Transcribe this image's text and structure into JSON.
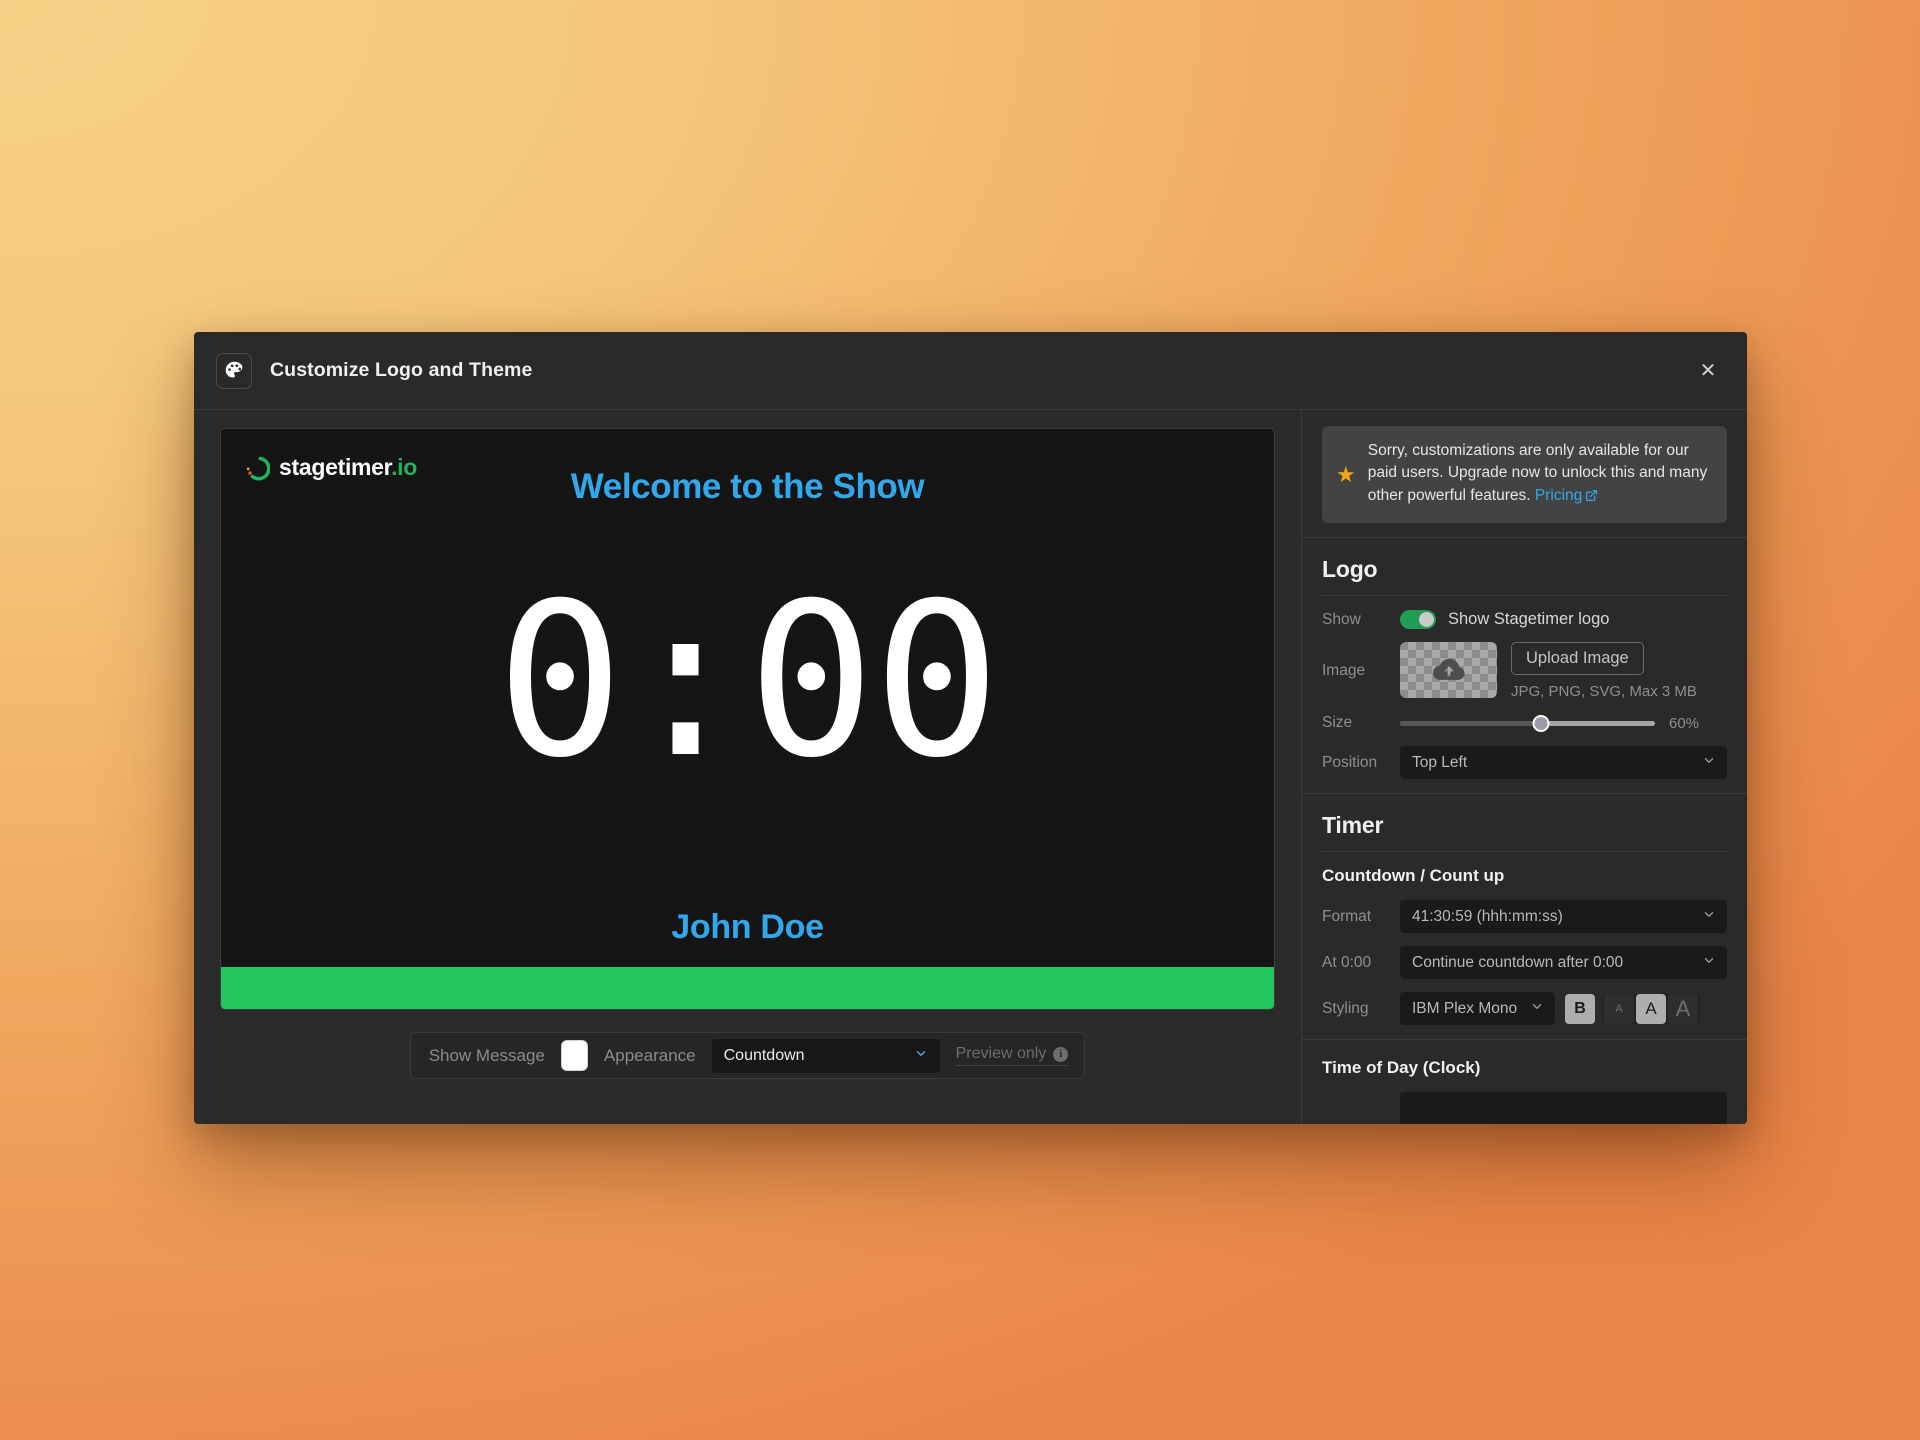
{
  "header": {
    "title": "Customize Logo and Theme",
    "icon": "palette-icon",
    "close": "✕"
  },
  "preview": {
    "logo_text": "stagetimer",
    "logo_tld": ".io",
    "title": "Welcome to the Show",
    "timer": "0:00",
    "name": "John Doe",
    "progress_color": "#22c55e",
    "title_color": "#32a8ec",
    "background": "#151515"
  },
  "preview_toolbar": {
    "show_message_label": "Show Message",
    "show_message_state": "off",
    "appearance_label": "Appearance",
    "appearance_value": "Countdown",
    "preview_only_label": "Preview only",
    "info_glyph": "i"
  },
  "notice": {
    "text": "Sorry, customizations are only available for our paid users. Upgrade now to unlock this and many other powerful features.",
    "link": "Pricing",
    "star": "★",
    "star_color": "#f2a71b",
    "link_color": "#32a8ec"
  },
  "logo_section": {
    "heading": "Logo",
    "show_label": "Show",
    "show_toggle_text": "Show Stagetimer logo",
    "show_toggle_state": "on",
    "toggle_color": "#1f9d55",
    "image_label": "Image",
    "upload_button": "Upload Image",
    "image_hint": "JPG, PNG, SVG, Max 3 MB",
    "size_label": "Size",
    "size_value": "60%",
    "size_percent": 60,
    "position_label": "Position",
    "position_value": "Top Left"
  },
  "timer_section": {
    "heading": "Timer",
    "subheading": "Countdown / Count up",
    "format_label": "Format",
    "format_value": "41:30:59 (hhh:mm:ss)",
    "at_zero_label": "At 0:00",
    "at_zero_value": "Continue countdown after 0:00",
    "styling_label": "Styling",
    "styling_font": "IBM Plex Mono",
    "bold_label": "B",
    "size_small": "A",
    "size_medium": "A",
    "size_large": "A",
    "bold_active": true,
    "size_active": "medium"
  },
  "clock_section": {
    "heading": "Time of Day (Clock)"
  }
}
